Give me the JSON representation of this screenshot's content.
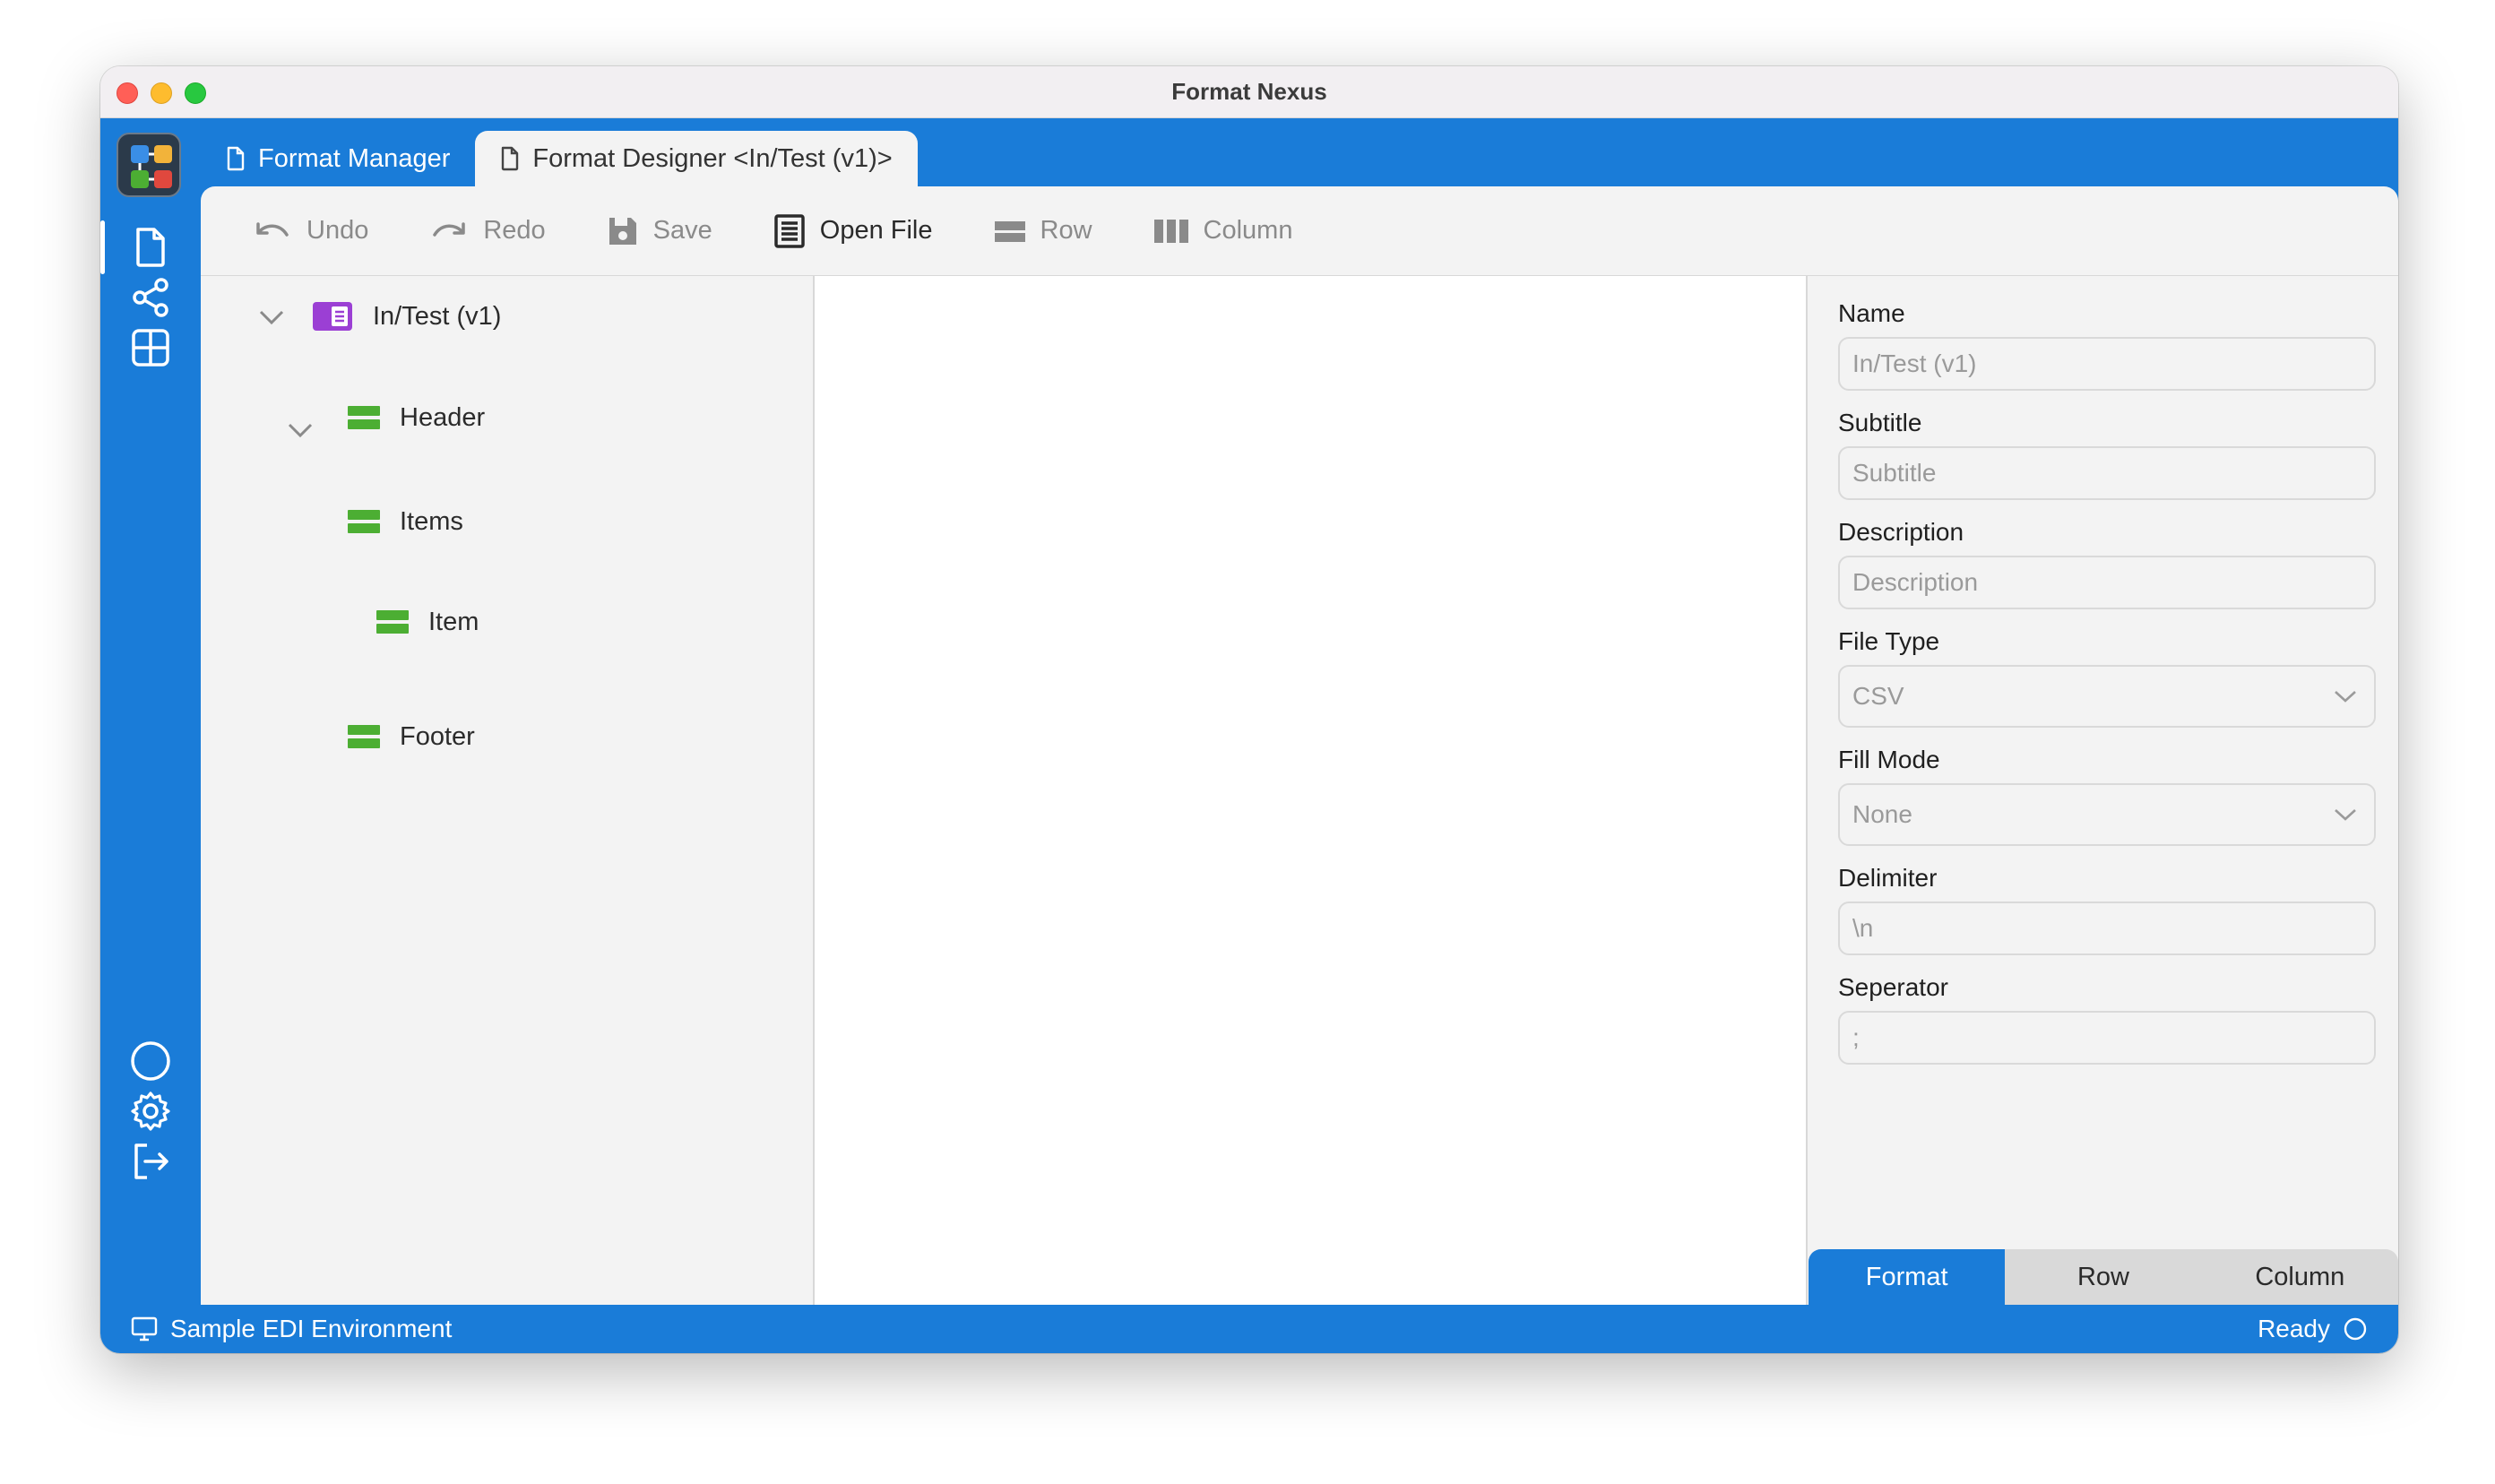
{
  "window": {
    "title": "Format Nexus"
  },
  "tabs": [
    {
      "label": "Format Manager",
      "icon": "document-icon"
    },
    {
      "label": "Format Designer <In/Test (v1)>",
      "icon": "document-icon"
    }
  ],
  "toolbar": {
    "undo": "Undo",
    "redo": "Redo",
    "save": "Save",
    "open_file": "Open File",
    "row": "Row",
    "column": "Column"
  },
  "tree": {
    "root": "In/Test (v1)",
    "header": "Header",
    "items": "Items",
    "item": "Item",
    "footer": "Footer"
  },
  "properties": {
    "name_label": "Name",
    "name_value": "In/Test (v1)",
    "subtitle_label": "Subtitle",
    "subtitle_placeholder": "Subtitle",
    "description_label": "Description",
    "description_placeholder": "Description",
    "file_type_label": "File Type",
    "file_type_value": "CSV",
    "fill_mode_label": "Fill Mode",
    "fill_mode_value": "None",
    "delimiter_label": "Delimiter",
    "delimiter_value": "\\n",
    "separator_label": "Seperator",
    "separator_value": ";"
  },
  "bottom_tabs": [
    "Format",
    "Row",
    "Column"
  ],
  "status": {
    "environment": "Sample EDI Environment",
    "state": "Ready"
  },
  "colors": {
    "accent": "#1a7cd8",
    "tree_row_icon": "#4cae33",
    "root_icon": "#9b3fd4"
  }
}
